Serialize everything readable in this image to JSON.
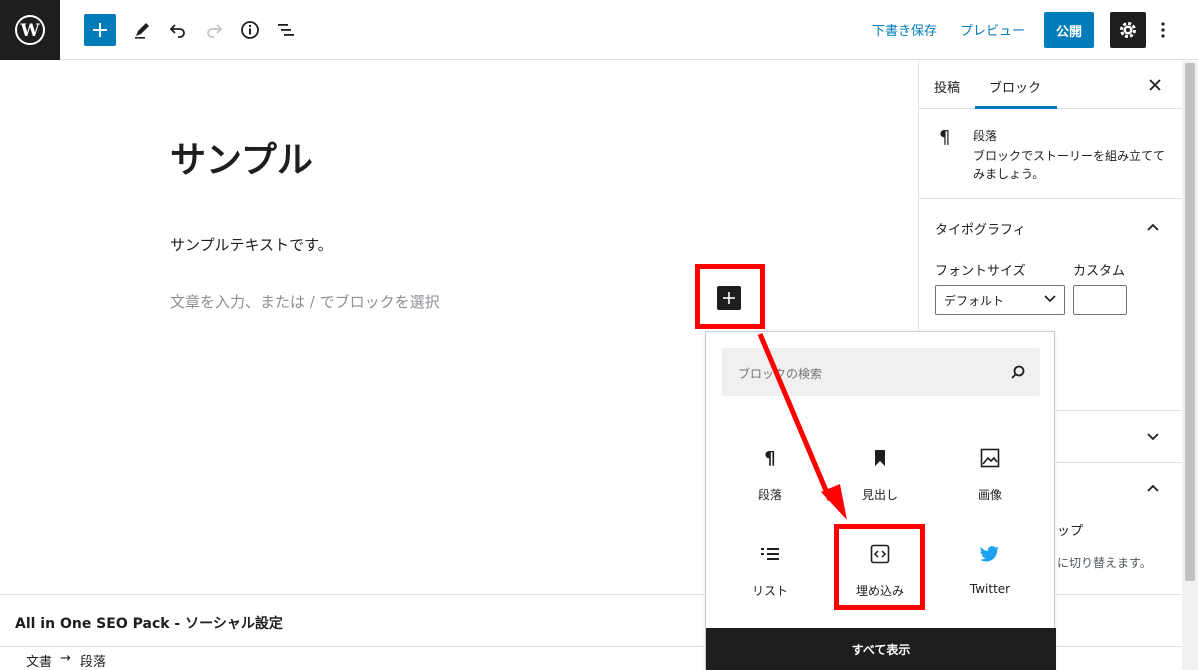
{
  "toolbar": {
    "save_draft": "下書き保存",
    "preview": "プレビュー",
    "publish": "公開"
  },
  "editor": {
    "title": "サンプル",
    "paragraph": "サンプルテキストです。",
    "placeholder": "文章を入力、または / でブロックを選択"
  },
  "sidebar": {
    "tabs": [
      "投稿",
      "ブロック"
    ],
    "active_tab": "ブロック",
    "block_name": "段落",
    "block_desc": "ブロックでストーリーを組み立ててみましょう。",
    "typography_title": "タイポグラフィ",
    "font_size_label": "フォントサイズ",
    "custom_label": "カスタム",
    "font_size_value": "デフォルト",
    "snippet_1": "ップ",
    "snippet_2": "に切り替えます。"
  },
  "inserter": {
    "search_placeholder": "ブロックの検索",
    "items": [
      {
        "label": "段落",
        "icon": "paragraph-icon"
      },
      {
        "label": "見出し",
        "icon": "bookmark-icon"
      },
      {
        "label": "画像",
        "icon": "image-icon"
      },
      {
        "label": "リスト",
        "icon": "list-icon"
      },
      {
        "label": "埋め込み",
        "icon": "embed-icon"
      },
      {
        "label": "Twitter",
        "icon": "twitter-icon"
      }
    ],
    "show_all": "すべて表示"
  },
  "seo": {
    "title": "All in One SEO Pack - ソーシャル設定"
  },
  "breadcrumb": {
    "items": [
      "文書",
      "段落"
    ],
    "separator": "→"
  },
  "colors": {
    "accent": "#007cba",
    "dark": "#1e1e1e",
    "highlight": "#ff0000",
    "twitter": "#1da1f2"
  }
}
